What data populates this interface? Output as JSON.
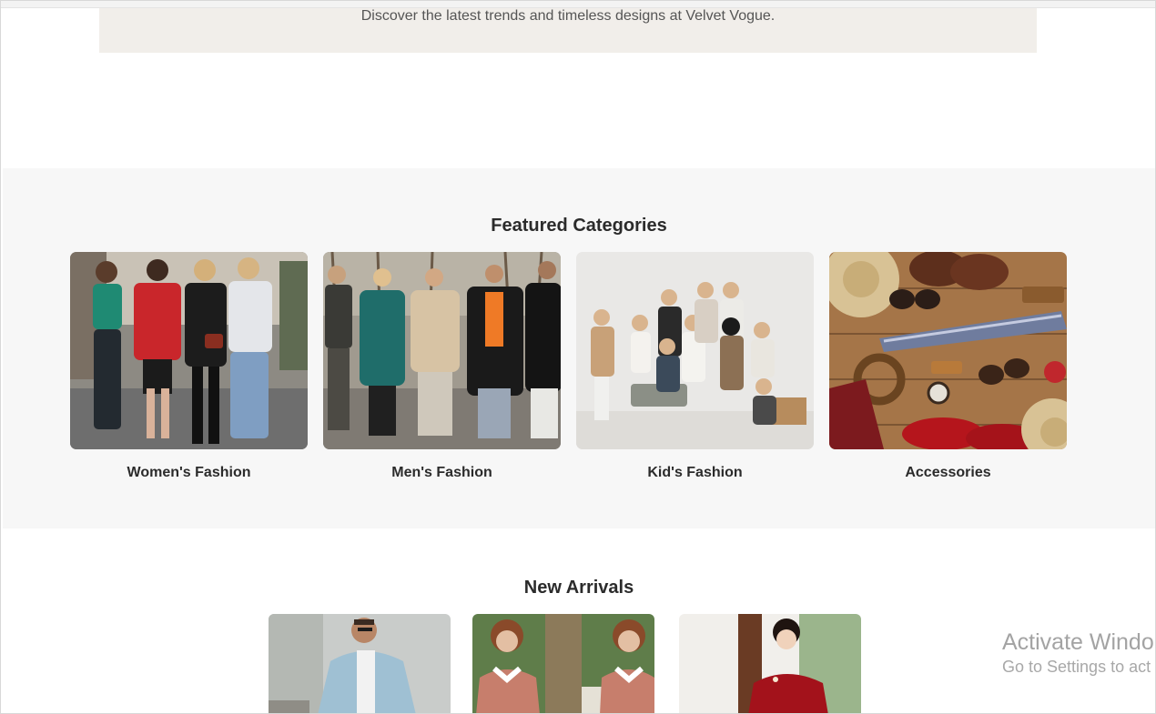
{
  "hero": {
    "subtitle": "Discover the latest trends and timeless designs at Velvet Vogue."
  },
  "featured": {
    "title": "Featured Categories",
    "categories": [
      {
        "label": "Women's Fashion",
        "image": "women-street-style-photo"
      },
      {
        "label": "Men's Fashion",
        "image": "men-street-style-photo"
      },
      {
        "label": "Kid's Fashion",
        "image": "kids-group-photo"
      },
      {
        "label": "Accessories",
        "image": "accessories-flatlay-photo"
      }
    ]
  },
  "arrivals": {
    "title": "New Arrivals",
    "products": [
      {
        "image": "man-denim-jacket-photo"
      },
      {
        "image": "women-collared-dress-photo"
      },
      {
        "image": "girl-red-dress-photo"
      }
    ]
  },
  "watermark": {
    "title": "Activate Windo",
    "subtitle": "Go to Settings to act"
  }
}
